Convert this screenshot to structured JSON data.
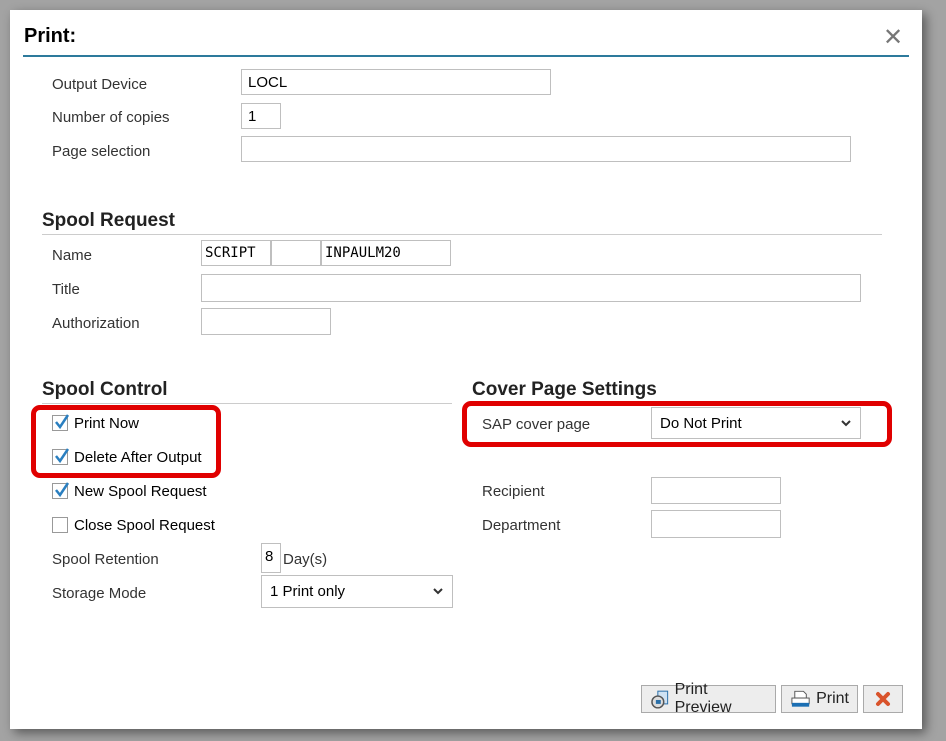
{
  "dialog": {
    "title": "Print:",
    "close_icon": "close-icon"
  },
  "output": {
    "output_device_label": "Output Device",
    "output_device_value": "LOCL",
    "copies_label": "Number of copies",
    "copies_value": "1",
    "page_selection_label": "Page selection",
    "page_selection_value": ""
  },
  "spool_request": {
    "heading": "Spool Request",
    "name_label": "Name",
    "name_part1": "SCRIPT",
    "name_part2": "",
    "name_part3": "INPAULM20",
    "title_label": "Title",
    "title_value": "",
    "authorization_label": "Authorization",
    "authorization_value": ""
  },
  "spool_control": {
    "heading": "Spool Control",
    "checkboxes": [
      {
        "label": "Print Now",
        "checked": true
      },
      {
        "label": "Delete After Output",
        "checked": true
      },
      {
        "label": "New Spool Request",
        "checked": true
      },
      {
        "label": "Close Spool Request",
        "checked": false
      }
    ],
    "retention_label": "Spool Retention",
    "retention_value": "8",
    "retention_unit": "Day(s)",
    "storage_mode_label": "Storage Mode",
    "storage_mode_value": "1 Print only"
  },
  "cover_page": {
    "heading": "Cover Page Settings",
    "sap_cover_label": "SAP cover page",
    "sap_cover_value": "Do Not Print",
    "recipient_label": "Recipient",
    "recipient_value": "",
    "department_label": "Department",
    "department_value": ""
  },
  "buttons": {
    "print_preview": "Print Preview",
    "print": "Print"
  },
  "colors": {
    "accent": "#2d7a9c",
    "highlight": "#e00000",
    "check": "#2a7fc0",
    "cancel": "#d9532b"
  }
}
